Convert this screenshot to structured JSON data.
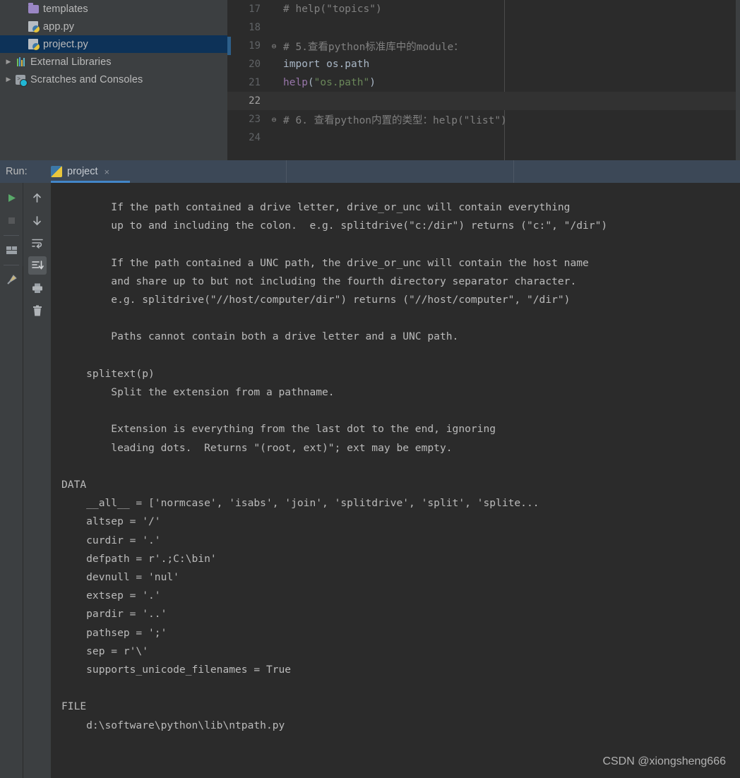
{
  "project_tree": {
    "items": [
      {
        "label": "templates",
        "icon": "folder-icon",
        "arrow": "",
        "indent": 38,
        "selected": false
      },
      {
        "label": "app.py",
        "icon": "python-file-icon",
        "arrow": "",
        "indent": 38,
        "selected": false
      },
      {
        "label": "project.py",
        "icon": "python-file-icon",
        "arrow": "",
        "indent": 38,
        "selected": true
      },
      {
        "label": "External Libraries",
        "icon": "libraries-icon",
        "arrow": "▶",
        "indent": 4,
        "selected": false
      },
      {
        "label": "Scratches and Consoles",
        "icon": "scratches-icon",
        "arrow": "▶",
        "indent": 4,
        "selected": false
      }
    ]
  },
  "editor": {
    "lines": [
      {
        "num": "17",
        "fold": "",
        "marker": "none",
        "current": false,
        "segments": [
          {
            "t": "# help(\"topics\")",
            "c": "c-comment"
          }
        ]
      },
      {
        "num": "18",
        "fold": "",
        "marker": "none",
        "current": false,
        "segments": []
      },
      {
        "num": "19",
        "fold": "⊖",
        "marker": "blue",
        "current": false,
        "segments": [
          {
            "t": "# 5.查看python标准库中的module：",
            "c": "c-comment"
          }
        ]
      },
      {
        "num": "20",
        "fold": "",
        "marker": "none",
        "current": false,
        "segments": [
          {
            "t": "import os.path",
            "c": "c-fn"
          }
        ]
      },
      {
        "num": "21",
        "fold": "",
        "marker": "none",
        "current": false,
        "segments": [
          {
            "t": "help",
            "c": "c-kw"
          },
          {
            "t": "(",
            "c": "c-paren"
          },
          {
            "t": "\"os.path\"",
            "c": "c-str"
          },
          {
            "t": ")",
            "c": "c-paren"
          }
        ]
      },
      {
        "num": "22",
        "fold": "",
        "marker": "none",
        "current": true,
        "segments": []
      },
      {
        "num": "23",
        "fold": "⊖",
        "marker": "none",
        "current": false,
        "segments": [
          {
            "t": "# 6. 查看python内置的类型：help(\"list\")",
            "c": "c-comment"
          }
        ]
      },
      {
        "num": "24",
        "fold": "",
        "marker": "none",
        "current": false,
        "segments": []
      }
    ]
  },
  "run_window": {
    "label": "Run:",
    "tab": {
      "title": "project",
      "icon": "python-icon",
      "close_icon": "×"
    }
  },
  "console_toolbar": {
    "left_buttons": [
      {
        "name": "rerun-button",
        "icon": "play-icon",
        "active": false
      },
      {
        "name": "stop-button",
        "icon": "stop-icon",
        "active": false
      },
      {
        "name": "layout-button",
        "icon": "layout-icon",
        "active": false
      },
      {
        "name": "pin-button",
        "icon": "pin-icon",
        "active": false
      }
    ],
    "right_buttons": [
      {
        "name": "prev-occurrence-button",
        "icon": "arrow-up-icon",
        "active": false
      },
      {
        "name": "next-occurrence-button",
        "icon": "arrow-down-icon",
        "active": false
      },
      {
        "name": "soft-wrap-button",
        "icon": "soft-wrap-icon",
        "active": false
      },
      {
        "name": "scroll-to-end-button",
        "icon": "scroll-end-icon",
        "active": true
      },
      {
        "name": "print-button",
        "icon": "printer-icon",
        "active": false
      },
      {
        "name": "clear-all-button",
        "icon": "trash-icon",
        "active": false
      }
    ]
  },
  "console": {
    "output": "        If the path contained a drive letter, drive_or_unc will contain everything\n        up to and including the colon.  e.g. splitdrive(\"c:/dir\") returns (\"c:\", \"/dir\")\n\n        If the path contained a UNC path, the drive_or_unc will contain the host name\n        and share up to but not including the fourth directory separator character.\n        e.g. splitdrive(\"//host/computer/dir\") returns (\"//host/computer\", \"/dir\")\n\n        Paths cannot contain both a drive letter and a UNC path.\n\n    splitext(p)\n        Split the extension from a pathname.\n\n        Extension is everything from the last dot to the end, ignoring\n        leading dots.  Returns \"(root, ext)\"; ext may be empty.\n\nDATA\n    __all__ = ['normcase', 'isabs', 'join', 'splitdrive', 'split', 'splite...\n    altsep = '/'\n    curdir = '.'\n    defpath = r'.;C:\\bin'\n    devnull = 'nul'\n    extsep = '.'\n    pardir = '..'\n    pathsep = ';'\n    sep = r'\\'\n    supports_unicode_filenames = True\n\nFILE\n    d:\\software\\python\\lib\\ntpath.py"
  },
  "watermark": {
    "text": "CSDN @xiongsheng666"
  },
  "colors": {
    "editor_bg": "#2b2b2b",
    "panel_bg": "#3c3f41",
    "selection_bg": "#0d3258",
    "run_header_bg": "#3c4857",
    "tab_underline": "#4286c9",
    "comment": "#808080",
    "keyword": "#9876aa",
    "string": "#6a8759",
    "text": "#a9b7c6",
    "console_text": "#bbbbbb"
  }
}
